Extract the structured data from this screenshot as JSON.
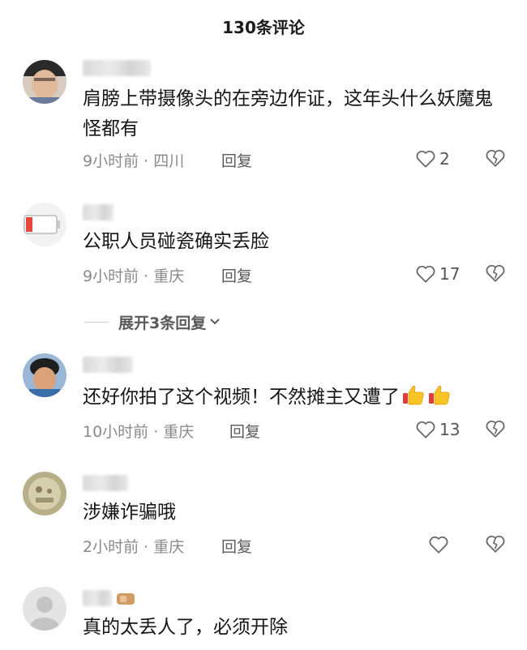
{
  "header": {
    "title": "130条评论"
  },
  "comments": [
    {
      "text": "肩膀上带摄像头的在旁边作证，这年头什么妖魔鬼怪都有",
      "meta": "9小时前 · 四川",
      "reply_label": "回复",
      "likes": "2"
    },
    {
      "text": "公职人员碰瓷确实丢脸",
      "meta": "9小时前 · 重庆",
      "reply_label": "回复",
      "likes": "17"
    },
    {
      "text": "还好你拍了这个视频！不然摊主又遭了",
      "meta": "10小时前 · 重庆",
      "reply_label": "回复",
      "likes": "13"
    },
    {
      "text": "涉嫌诈骗哦",
      "meta": "2小时前 · 重庆",
      "reply_label": "回复",
      "likes": ""
    },
    {
      "text": "真的太丢人了，必须开除"
    }
  ],
  "expand_replies": {
    "label": "展开3条回复"
  },
  "icons": {
    "like": "heart-outline-icon",
    "dislike": "broken-heart-icon",
    "chevron": "chevron-down-icon",
    "emoji": "thumbs-up-emoji"
  }
}
